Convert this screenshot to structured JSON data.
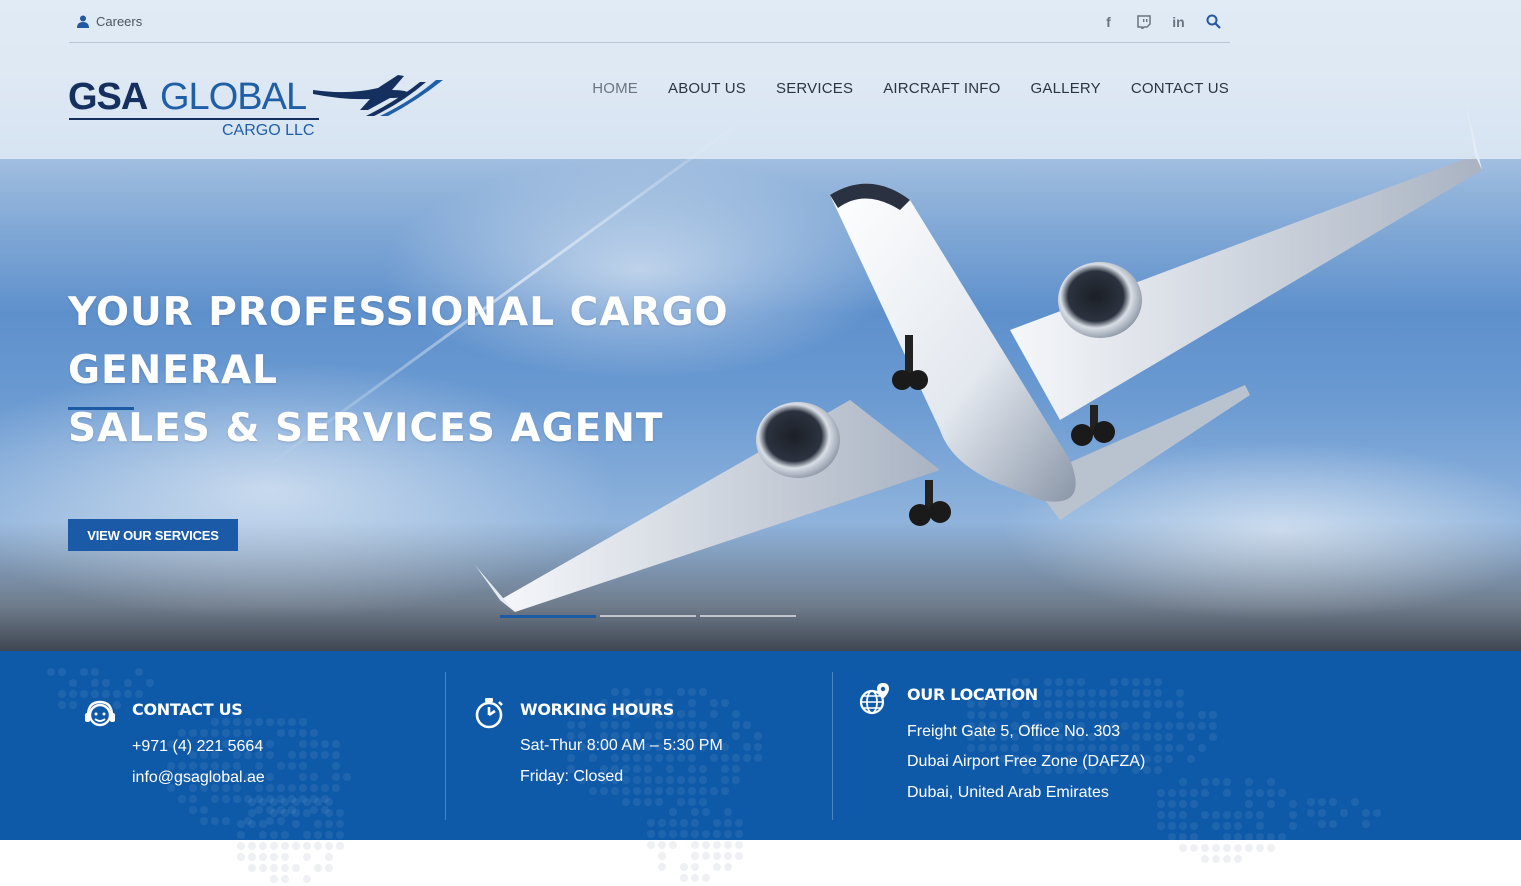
{
  "topbar": {
    "careers_label": "Careers"
  },
  "logo": {
    "gsa": "GSA",
    "global": "GLOBAL",
    "sub": "CARGO LLC"
  },
  "nav": [
    {
      "label": "HOME",
      "active": true
    },
    {
      "label": "ABOUT US"
    },
    {
      "label": "SERVICES"
    },
    {
      "label": "AIRCRAFT INFO"
    },
    {
      "label": "GALLERY"
    },
    {
      "label": "CONTACT US"
    }
  ],
  "social": [
    "facebook-icon",
    "twitch-icon",
    "linkedin-icon",
    "search-icon"
  ],
  "hero": {
    "title_line1": "YOUR PROFESSIONAL CARGO GENERAL",
    "title_line2": "SALES & SERVICES AGENT",
    "cta": "VIEW OUR SERVICES",
    "slides": 3,
    "active_slide": 1
  },
  "info": {
    "contact": {
      "title": "CONTACT US",
      "phone": "+971 (4) 221 5664",
      "email": "info@gsaglobal.ae"
    },
    "hours": {
      "title": "WORKING HOURS",
      "line1": "Sat-Thur 8:00 AM – 5:30 PM",
      "line2": "Friday: Closed"
    },
    "location": {
      "title": "OUR LOCATION",
      "line1": "Freight Gate 5, Office No. 303",
      "line2": "Dubai Airport Free Zone (DAFZA)",
      "line3": "Dubai, United Arab Emirates"
    }
  },
  "colors": {
    "brand_blue": "#0f5aa8",
    "navy": "#15305e",
    "accent": "#1b5aa5"
  }
}
